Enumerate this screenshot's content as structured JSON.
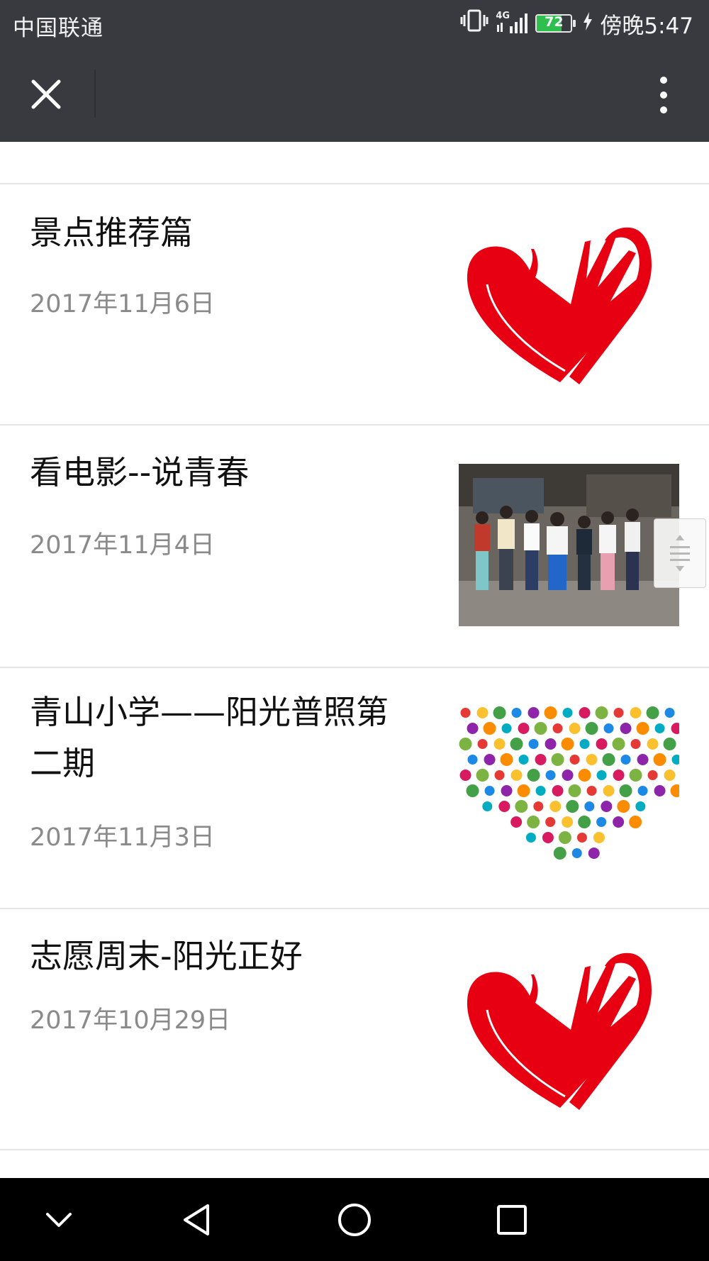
{
  "status_bar": {
    "carrier": "中国联通",
    "network": "4G",
    "battery": "72",
    "time": "傍晚5:47"
  },
  "toolbar": {
    "close_icon": "close-icon",
    "more_icon": "more-vertical-icon"
  },
  "articles": [
    {
      "title": "景点推荐篇",
      "date": "2017年11月6日",
      "thumbnail": "volunteer-heart-logo"
    },
    {
      "title": "看电影--说青春",
      "date": "2017年11月4日",
      "thumbnail": "group-photo"
    },
    {
      "title": "青山小学——阳光普照第二期",
      "date": "2017年11月3日",
      "thumbnail": "flower-heart"
    },
    {
      "title": "志愿周末-阳光正好",
      "date": "2017年10月29日",
      "thumbnail": "volunteer-heart-logo"
    }
  ],
  "colors": {
    "bar_background": "#393a3f",
    "logo_red": "#e60012",
    "date_text": "#8a8a8a",
    "battery_fill": "#2fbf4f"
  }
}
